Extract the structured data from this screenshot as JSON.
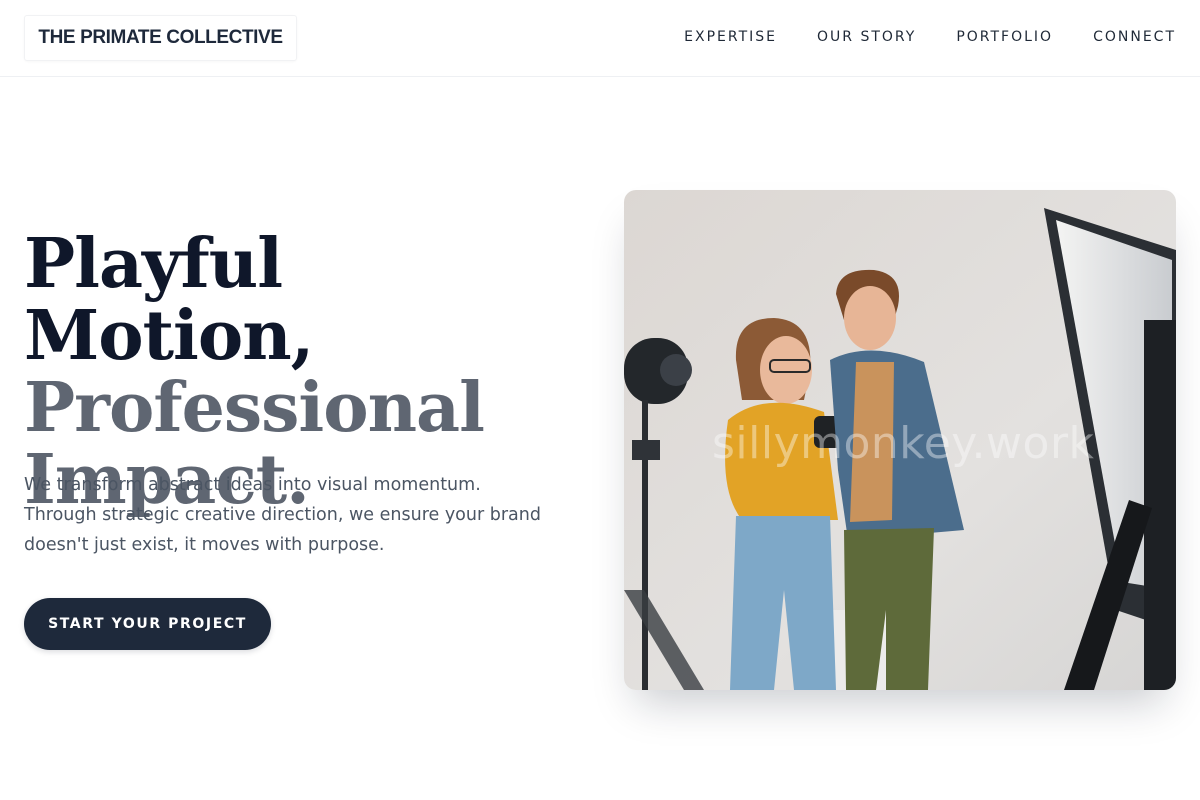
{
  "header": {
    "brand": "THE PRIMATE COLLECTIVE",
    "nav": [
      {
        "label": "EXPERTISE"
      },
      {
        "label": "OUR STORY"
      },
      {
        "label": "PORTFOLIO"
      },
      {
        "label": "CONNECT"
      }
    ]
  },
  "hero": {
    "title_line1": "Playful Motion,",
    "title_line2": "Professional",
    "title_line3": "Impact.",
    "description": "We transform abstract ideas into visual momentum. Through strategic creative direction, we ensure your brand doesn't just exist, it moves with purpose.",
    "cta_label": "START YOUR PROJECT",
    "image_watermark": "sillymonkey.work"
  },
  "colors": {
    "primary_dark": "#1e293b",
    "heading": "#0f172a",
    "heading_muted": "#5f6672",
    "body_text": "#4b5563",
    "background": "#ffffff"
  }
}
